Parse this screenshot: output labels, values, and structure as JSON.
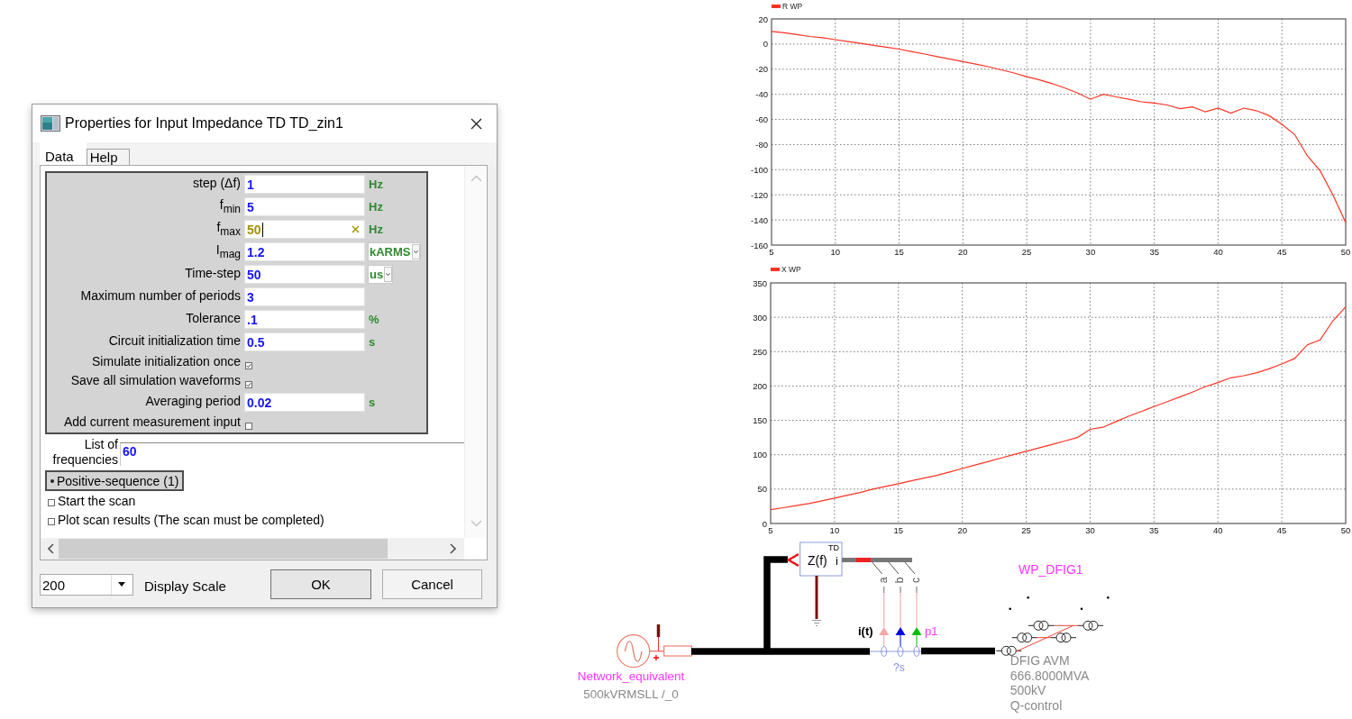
{
  "dialog": {
    "title": "Properties for Input Impedance TD TD_zin1",
    "tabs": [
      {
        "label": "Data",
        "selected": true
      },
      {
        "label": "Help",
        "selected": false
      }
    ],
    "parameters": [
      {
        "kind": "field",
        "label": "step (Δf)",
        "value": "1",
        "unit": "Hz",
        "unit_dropdown": false,
        "editing": false
      },
      {
        "kind": "field",
        "label": "f$_{min}$",
        "value": "5",
        "unit": "Hz",
        "unit_dropdown": false,
        "editing": false
      },
      {
        "kind": "field",
        "label": "f$_{max}$",
        "value": "50",
        "unit": "Hz",
        "unit_dropdown": false,
        "editing": true
      },
      {
        "kind": "field",
        "label": "I$_{mag}$",
        "value": "1.2",
        "unit": "kARMS",
        "unit_dropdown": true,
        "editing": false
      },
      {
        "kind": "field",
        "label": "Time-step",
        "value": "50",
        "unit": "us",
        "unit_dropdown": true,
        "editing": false
      },
      {
        "kind": "field",
        "label": "Maximum number of periods",
        "value": "3",
        "editing": false
      },
      {
        "kind": "field",
        "label": "Tolerance",
        "value": ".1",
        "unit": "%",
        "unit_dropdown": false,
        "editing": false
      },
      {
        "kind": "field",
        "label": "Circuit initialization time",
        "value": "0.5",
        "unit": "s",
        "unit_dropdown": false,
        "editing": false
      },
      {
        "kind": "checkbox",
        "label": "Simulate initialization once",
        "checked": true
      },
      {
        "kind": "checkbox",
        "label": "Save all simulation waveforms",
        "checked": true
      },
      {
        "kind": "field",
        "label": "Averaging period",
        "value": "0.02",
        "unit": "s",
        "unit_dropdown": false,
        "editing": false
      },
      {
        "kind": "checkbox",
        "label": "Add current measurement input",
        "checked": false
      }
    ],
    "frequency_list": {
      "label": "List of frequencies",
      "value": "60"
    },
    "sequence": {
      "label": "Positive-sequence (1)",
      "selected": true
    },
    "actions": [
      {
        "label": "Start the scan",
        "checked": false
      },
      {
        "label": "Plot scan results (The scan must be completed)",
        "checked": false
      }
    ],
    "display_scale": {
      "value": "200",
      "label": "Display Scale"
    },
    "buttons": [
      {
        "label": "OK",
        "default": true
      },
      {
        "label": "Cancel",
        "default": false
      }
    ]
  },
  "plots": [
    {
      "chart_data": {
        "type": "line",
        "grid": true,
        "x": [
          5,
          6,
          7,
          8,
          9,
          10,
          11,
          12,
          13,
          14,
          15,
          16,
          17,
          18,
          19,
          20,
          21,
          22,
          23,
          24,
          25,
          26,
          27,
          28,
          29,
          30,
          31,
          32,
          33,
          34,
          35,
          36,
          37,
          38,
          39,
          40,
          41,
          42,
          43,
          44,
          45,
          46,
          47,
          48,
          49,
          50
        ],
        "series": [
          {
            "name": "R WP",
            "color": "#ff3322",
            "values": [
              10,
              9,
              7.5,
              6,
              5,
              3.5,
              2,
              0.5,
              -1,
              -2.5,
              -4,
              -6,
              -8,
              -10,
              -12,
              -14,
              -16,
              -18,
              -20.5,
              -23,
              -26,
              -28.5,
              -31.5,
              -35,
              -39,
              -44,
              -40,
              -42,
              -44,
              -46,
              -47,
              -48.5,
              -51.5,
              -50,
              -54,
              -51,
              -55,
              -51,
              -53,
              -57,
              -64,
              -72,
              -89,
              -101,
              -120,
              -142
            ]
          }
        ],
        "xlim": [
          5,
          50
        ],
        "ylim": [
          -160,
          20
        ],
        "xticks": [
          5,
          10,
          15,
          20,
          25,
          30,
          35,
          40,
          45,
          50
        ],
        "yticks": [
          -160,
          -140,
          -120,
          -100,
          -80,
          -60,
          -40,
          -20,
          0,
          20
        ]
      }
    },
    {
      "chart_data": {
        "type": "line",
        "grid": true,
        "x": [
          5,
          6,
          7,
          8,
          9,
          10,
          11,
          12,
          13,
          14,
          15,
          16,
          17,
          18,
          19,
          20,
          21,
          22,
          23,
          24,
          25,
          26,
          27,
          28,
          29,
          30,
          31,
          32,
          33,
          34,
          35,
          36,
          37,
          38,
          39,
          40,
          41,
          42,
          43,
          44,
          45,
          46,
          47,
          48,
          49,
          50
        ],
        "series": [
          {
            "name": "X WP",
            "color": "#ff3322",
            "values": [
              20,
              23,
              26,
              29,
              33,
              37,
              41,
              45,
              50,
              54,
              58,
              62,
              66,
              70,
              75,
              80,
              85,
              90,
              95,
              100,
              105,
              110,
              115,
              120,
              125,
              137,
              140,
              148,
              156,
              163,
              170,
              177,
              184,
              191,
              199,
              205,
              212,
              215,
              219,
              225,
              232,
              240,
              260,
              267,
              295,
              315
            ]
          }
        ],
        "xlim": [
          5,
          50
        ],
        "ylim": [
          0,
          350
        ],
        "xticks": [
          5,
          10,
          15,
          20,
          25,
          30,
          35,
          40,
          45,
          50
        ],
        "yticks": [
          0,
          50,
          100,
          150,
          200,
          250,
          300,
          350
        ]
      }
    }
  ],
  "schematic": {
    "source": {
      "name": "Network_equivalent",
      "rating": "500kVRMSLL /_0"
    },
    "impedance_block": {
      "tag": "TD",
      "symbol": "Z(f)",
      "port": "i"
    },
    "phases": [
      {
        "label": "a",
        "color": "#f7a6a6"
      },
      {
        "label": "b",
        "color": "#0000e6"
      },
      {
        "label": "c",
        "color": "#00c000"
      }
    ],
    "current_label": "i(t)",
    "power_label": "p1",
    "probe_label": "?s",
    "generator": {
      "name": "WP_DFIG1",
      "details": [
        "DFIG AVM",
        "666.8000MVA",
        "500kV",
        "Q-control"
      ]
    }
  }
}
